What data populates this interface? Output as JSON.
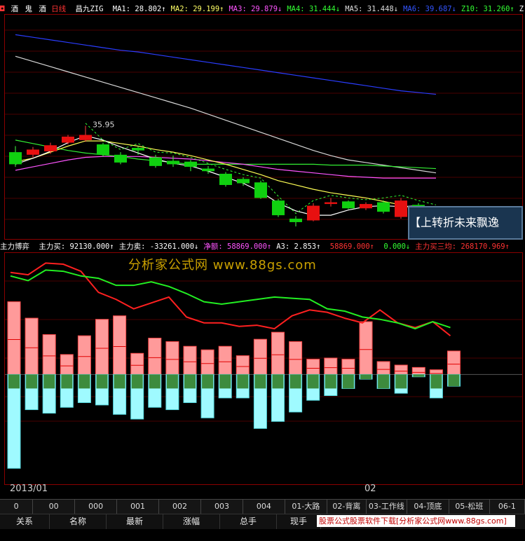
{
  "price_panel": {
    "title_parts": [
      "酒",
      "鬼",
      "酒"
    ],
    "period": "日线",
    "indicator": "昌九ZIG",
    "ma": [
      {
        "label": "MA1:",
        "value": "28.802",
        "arrow": "↑",
        "color": "#ffffff"
      },
      {
        "label": "MA2:",
        "value": "29.199",
        "arrow": "↑",
        "color": "#ffff66"
      },
      {
        "label": "MA3:",
        "value": "29.879",
        "arrow": "↓",
        "color": "#ff55ff"
      },
      {
        "label": "MA4:",
        "value": "31.444",
        "arrow": "↓",
        "color": "#33ff33"
      },
      {
        "label": "MA5:",
        "value": "31.448",
        "arrow": "↓",
        "color": "#dddddd"
      },
      {
        "label": "MA6:",
        "value": "39.687",
        "arrow": "↓",
        "color": "#3355ff"
      },
      {
        "label": "Z10:",
        "value": "31.260",
        "arrow": "↑",
        "color": "#33ff33"
      },
      {
        "label": "Z",
        "value": "",
        "arrow": "",
        "color": "#ffffff"
      }
    ],
    "peak_label": "35.95"
  },
  "indicator_panel": {
    "name": "主力博弈",
    "values": [
      {
        "label": "主力买:",
        "value": "92130.000",
        "arrow": "↑",
        "color": "#ffffff"
      },
      {
        "label": "主力卖:",
        "value": "-33261.000",
        "arrow": "↓",
        "color": "#ffffff"
      },
      {
        "label": "净额:",
        "value": "58869.000",
        "arrow": "↑",
        "color": "#ff55ff"
      },
      {
        "label": "A3:",
        "value": "2.853",
        "arrow": "↑",
        "color": "#ffffff"
      },
      {
        "label": "",
        "value": "58869.000",
        "arrow": "↑",
        "color": "#ff3333"
      },
      {
        "label": "",
        "value": "0.000",
        "arrow": "↓",
        "color": "#33ff33"
      },
      {
        "label": "主力买三均:",
        "value": "268170.969",
        "arrow": "↑",
        "color": "#ff3333"
      }
    ]
  },
  "watermark": "分析家公式网 www.88gs.com",
  "marquee": "【上转折未来飘逸",
  "dates": [
    "2013/01",
    "02"
  ],
  "tabs": [
    "0",
    "00",
    "000",
    "001",
    "002",
    "003",
    "004",
    "01-大路",
    "02-背离",
    "03-工作线",
    "04-顶底",
    "05-松班",
    "06-1"
  ],
  "header_cols": [
    "关系",
    "名称",
    "最新",
    "涨幅",
    "总手",
    "现手"
  ],
  "banner_text": "股票公式股票软件下载[分析家公式网www.88gs.com]",
  "chart_data": {
    "type": "candlestick",
    "candles": [
      {
        "o": 32.9,
        "c": 31.5,
        "h": 33.6,
        "l": 31.2
      },
      {
        "o": 32.6,
        "c": 33.2,
        "h": 33.5,
        "l": 32.3
      },
      {
        "o": 33.0,
        "c": 33.7,
        "h": 34.0,
        "l": 32.7
      },
      {
        "o": 34.0,
        "c": 34.7,
        "h": 34.9,
        "l": 33.8
      },
      {
        "o": 34.3,
        "c": 34.9,
        "h": 35.95,
        "l": 34.1
      },
      {
        "o": 33.8,
        "c": 32.6,
        "h": 34.0,
        "l": 32.4
      },
      {
        "o": 32.6,
        "c": 31.7,
        "h": 32.9,
        "l": 31.5
      },
      {
        "o": 33.4,
        "c": 33.1,
        "h": 33.6,
        "l": 32.6
      },
      {
        "o": 32.3,
        "c": 31.3,
        "h": 32.6,
        "l": 31.1
      },
      {
        "o": 31.9,
        "c": 31.5,
        "h": 32.5,
        "l": 31.2
      },
      {
        "o": 31.8,
        "c": 31.2,
        "h": 32.0,
        "l": 30.7
      },
      {
        "o": 31.0,
        "c": 30.7,
        "h": 31.3,
        "l": 30.4
      },
      {
        "o": 30.4,
        "c": 29.1,
        "h": 30.6,
        "l": 28.9
      },
      {
        "o": 29.8,
        "c": 29.3,
        "h": 30.0,
        "l": 29.0
      },
      {
        "o": 29.4,
        "c": 27.6,
        "h": 29.6,
        "l": 27.5
      },
      {
        "o": 27.3,
        "c": 25.6,
        "h": 27.5,
        "l": 25.4
      },
      {
        "o": 25.2,
        "c": 24.8,
        "h": 25.5,
        "l": 24.3
      },
      {
        "o": 25.0,
        "c": 26.7,
        "h": 27.0,
        "l": 24.9
      },
      {
        "o": 26.9,
        "c": 27.1,
        "h": 27.6,
        "l": 26.6
      },
      {
        "o": 27.2,
        "c": 26.4,
        "h": 27.3,
        "l": 26.3
      },
      {
        "o": 26.4,
        "c": 26.9,
        "h": 27.1,
        "l": 26.2
      },
      {
        "o": 27.1,
        "c": 26.0,
        "h": 27.3,
        "l": 25.8
      },
      {
        "o": 25.4,
        "c": 27.3,
        "h": 27.6,
        "l": 25.2
      },
      {
        "o": 26.8,
        "c": 26.3,
        "h": 27.0,
        "l": 25.9
      },
      {
        "o": 26.2,
        "c": 25.6,
        "h": 26.5,
        "l": 25.3
      }
    ],
    "lines": [
      {
        "name": "MA6",
        "color": "#2a3dff",
        "values": [
          46.5,
          46.2,
          45.9,
          45.6,
          45.3,
          45.0,
          44.7,
          44.5,
          44.2,
          43.9,
          43.6,
          43.3,
          43.0,
          42.7,
          42.4,
          42.1,
          41.8,
          41.5,
          41.2,
          40.9,
          40.6,
          40.3,
          40.0,
          39.8,
          39.6
        ]
      },
      {
        "name": "MA5",
        "color": "#d8d8d8",
        "values": [
          44.0,
          43.4,
          42.8,
          42.2,
          41.6,
          41.0,
          40.4,
          39.8,
          39.2,
          38.6,
          38.0,
          37.3,
          36.6,
          35.9,
          35.2,
          34.5,
          33.8,
          33.1,
          32.5,
          32.0,
          31.7,
          31.4,
          31.1,
          30.8,
          30.5
        ]
      },
      {
        "name": "MA4",
        "color": "#33ee33",
        "values": [
          34.3,
          33.9,
          33.5,
          33.1,
          32.8,
          32.6,
          32.4,
          32.1,
          31.9,
          31.7,
          31.5,
          31.5,
          31.5,
          31.5,
          31.5,
          31.5,
          31.5,
          31.5,
          31.4,
          31.4,
          31.4,
          31.3,
          31.2,
          31.1,
          31.0
        ]
      },
      {
        "name": "MA3",
        "color": "#ff55ff",
        "values": [
          30.8,
          31.2,
          31.6,
          32.0,
          32.3,
          32.4,
          32.4,
          32.4,
          32.3,
          32.2,
          32.1,
          31.9,
          31.7,
          31.5,
          31.2,
          30.9,
          30.7,
          30.5,
          30.3,
          30.1,
          30.0,
          29.9,
          29.9,
          29.9,
          29.9
        ]
      },
      {
        "name": "MA2",
        "color": "#ffff55",
        "values": [
          31.8,
          32.2,
          32.9,
          33.6,
          34.2,
          34.2,
          33.9,
          33.6,
          33.2,
          32.9,
          32.5,
          32.0,
          31.5,
          30.9,
          30.3,
          29.6,
          29.1,
          28.6,
          28.2,
          27.9,
          27.6,
          27.2,
          26.8,
          26.2,
          25.6
        ]
      },
      {
        "name": "MA1",
        "color": "#ffffff",
        "values": [
          31.5,
          32.2,
          33.0,
          34.0,
          34.8,
          34.3,
          33.5,
          32.8,
          32.1,
          31.6,
          31.3,
          30.7,
          30.0,
          29.3,
          28.3,
          27.0,
          26.1,
          25.6,
          25.6,
          26.2,
          26.6,
          26.7,
          26.6,
          26.7,
          26.4
        ]
      }
    ],
    "ylim": [
      23.5,
      48
    ]
  },
  "indicator_chart": {
    "red_line": [
      87,
      85,
      95,
      94,
      88,
      70,
      64,
      56,
      61,
      66,
      49,
      44,
      44,
      41,
      42,
      39,
      50,
      55,
      53,
      48,
      44,
      55,
      44,
      40,
      45,
      33
    ],
    "green_line": [
      84,
      80,
      89,
      88,
      84,
      82,
      76,
      76,
      79,
      75,
      69,
      62,
      60,
      62,
      64,
      66,
      65,
      64,
      56,
      54,
      49,
      47,
      44,
      39,
      45,
      40
    ],
    "bars_pos": [
      62,
      48,
      34,
      17,
      33,
      47,
      50,
      18,
      31,
      28,
      24,
      21,
      24,
      16,
      30,
      36,
      28,
      13,
      14,
      13,
      45,
      11,
      8,
      6,
      4,
      20
    ],
    "bars_neg": [
      -80,
      -30,
      -33,
      -28,
      -24,
      -26,
      -34,
      -38,
      -28,
      -30,
      -24,
      -37,
      -20,
      -20,
      -46,
      -40,
      -32,
      -22,
      -18,
      -12,
      -4,
      -12,
      -16,
      -2,
      -20,
      -10
    ],
    "ylim": [
      -90,
      100
    ]
  }
}
